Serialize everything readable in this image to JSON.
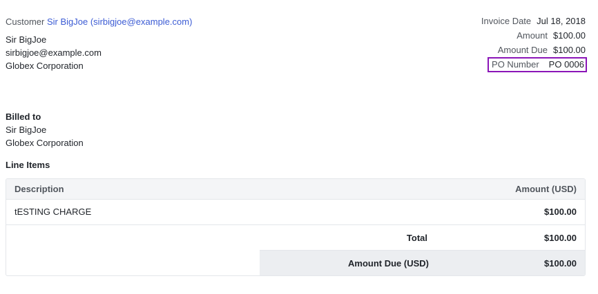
{
  "customer": {
    "label": "Customer",
    "link_text": "Sir BigJoe (sirbigjoe@example.com)",
    "name": "Sir BigJoe",
    "email": "sirbigjoe@example.com",
    "company": "Globex Corporation"
  },
  "meta": {
    "invoice_date_label": "Invoice Date",
    "invoice_date": "Jul 18, 2018",
    "amount_label": "Amount",
    "amount": "$100.00",
    "amount_due_label": "Amount Due",
    "amount_due": "$100.00",
    "po_number_label": "PO Number",
    "po_number": "PO 0006"
  },
  "billed_to": {
    "heading": "Billed to",
    "name": "Sir BigJoe",
    "company": "Globex Corporation"
  },
  "line_items": {
    "heading": "Line Items",
    "columns": {
      "description": "Description",
      "amount": "Amount (USD)"
    },
    "rows": [
      {
        "description": "tESTING CHARGE",
        "amount": "$100.00"
      }
    ],
    "total_label": "Total",
    "total": "$100.00",
    "amount_due_label": "Amount Due (USD)",
    "amount_due": "$100.00"
  },
  "colors": {
    "link": "#3b5bd4",
    "highlight_border": "#8a14b7"
  }
}
